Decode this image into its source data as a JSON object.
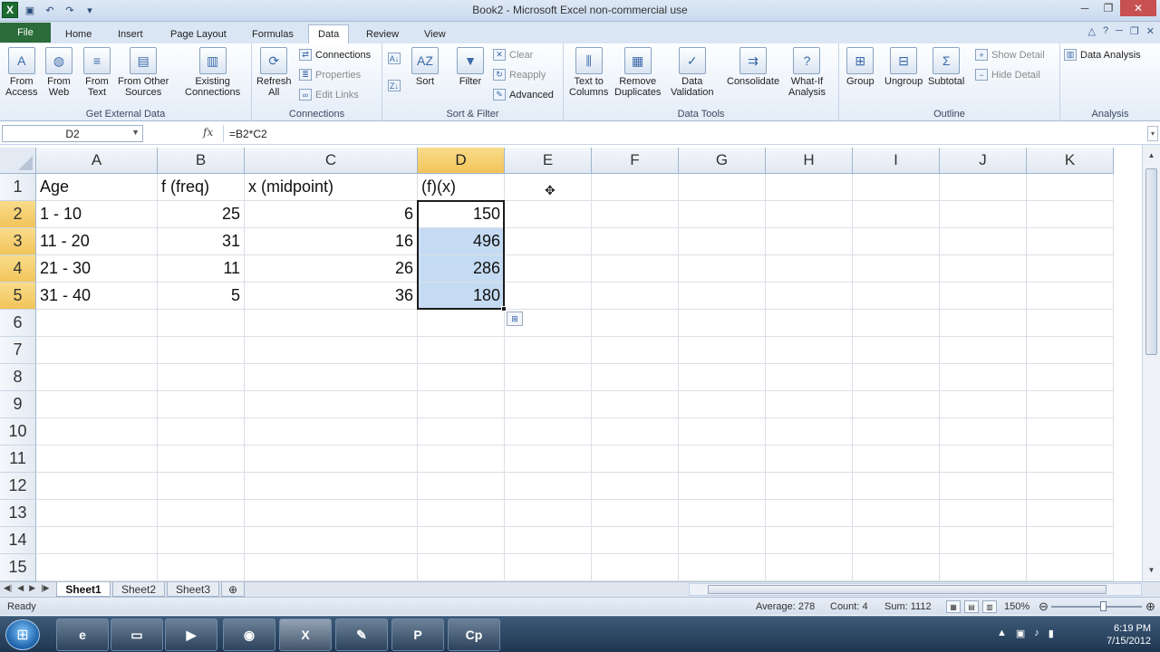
{
  "window": {
    "title": "Book2 - Microsoft Excel non-commercial use"
  },
  "tabs": [
    {
      "label": "File"
    },
    {
      "label": "Home"
    },
    {
      "label": "Insert"
    },
    {
      "label": "Page Layout"
    },
    {
      "label": "Formulas"
    },
    {
      "label": "Data"
    },
    {
      "label": "Review"
    },
    {
      "label": "View"
    }
  ],
  "ribbon": {
    "get_external": {
      "from_access_1": "From",
      "from_access_2": "Access",
      "from_web_1": "From",
      "from_web_2": "Web",
      "from_text_1": "From",
      "from_text_2": "Text",
      "from_other_1": "From Other",
      "from_other_2": "Sources",
      "existing_1": "Existing",
      "existing_2": "Connections",
      "label": "Get External Data"
    },
    "connections": {
      "refresh_1": "Refresh",
      "refresh_2": "All",
      "connections": "Connections",
      "properties": "Properties",
      "edit_links": "Edit Links",
      "label": "Connections"
    },
    "sort_filter": {
      "sort": "Sort",
      "filter": "Filter",
      "clear": "Clear",
      "reapply": "Reapply",
      "advanced": "Advanced",
      "label": "Sort & Filter"
    },
    "data_tools": {
      "text_cols_1": "Text to",
      "text_cols_2": "Columns",
      "remove_dup_1": "Remove",
      "remove_dup_2": "Duplicates",
      "validation_1": "Data",
      "validation_2": "Validation",
      "consolidate": "Consolidate",
      "whatif_1": "What-If",
      "whatif_2": "Analysis",
      "label": "Data Tools"
    },
    "outline": {
      "group": "Group",
      "ungroup": "Ungroup",
      "subtotal": "Subtotal",
      "show_detail": "Show Detail",
      "hide_detail": "Hide Detail",
      "label": "Outline"
    },
    "analysis": {
      "data_analysis": "Data Analysis",
      "label": "Analysis"
    }
  },
  "formula_bar": {
    "name_box": "D2",
    "fx": "fx",
    "formula": "=B2*C2"
  },
  "columns": [
    "A",
    "B",
    "C",
    "D",
    "E",
    "F",
    "G",
    "H",
    "I",
    "J",
    "K"
  ],
  "rows": [
    "1",
    "2",
    "3",
    "4",
    "5",
    "6",
    "7",
    "8",
    "9",
    "10",
    "11",
    "12",
    "13",
    "14",
    "15"
  ],
  "cells": {
    "A1": "Age",
    "B1": "f (freq)",
    "C1": "x (midpoint)",
    "D1": "(f)(x)",
    "A2": "1 - 10",
    "B2": "25",
    "C2": "6",
    "D2": "150",
    "A3": "11 - 20",
    "B3": "31",
    "C3": "16",
    "D3": "496",
    "A4": "21 - 30",
    "B4": "11",
    "C4": "26",
    "D4": "286",
    "A5": "31 - 40",
    "B5": "5",
    "C5": "36",
    "D5": "180"
  },
  "sheets": [
    "Sheet1",
    "Sheet2",
    "Sheet3"
  ],
  "status": {
    "ready": "Ready",
    "average": "Average: 278",
    "count": "Count: 4",
    "sum": "Sum: 1112",
    "zoom": "150%"
  },
  "taskbar": {
    "time": "6:19 PM",
    "date": "7/15/2012"
  },
  "colors": {
    "file_tab": "#2b6c3a",
    "selected_header": "#f2c45a",
    "selection_fill": "#c5dbf3"
  }
}
